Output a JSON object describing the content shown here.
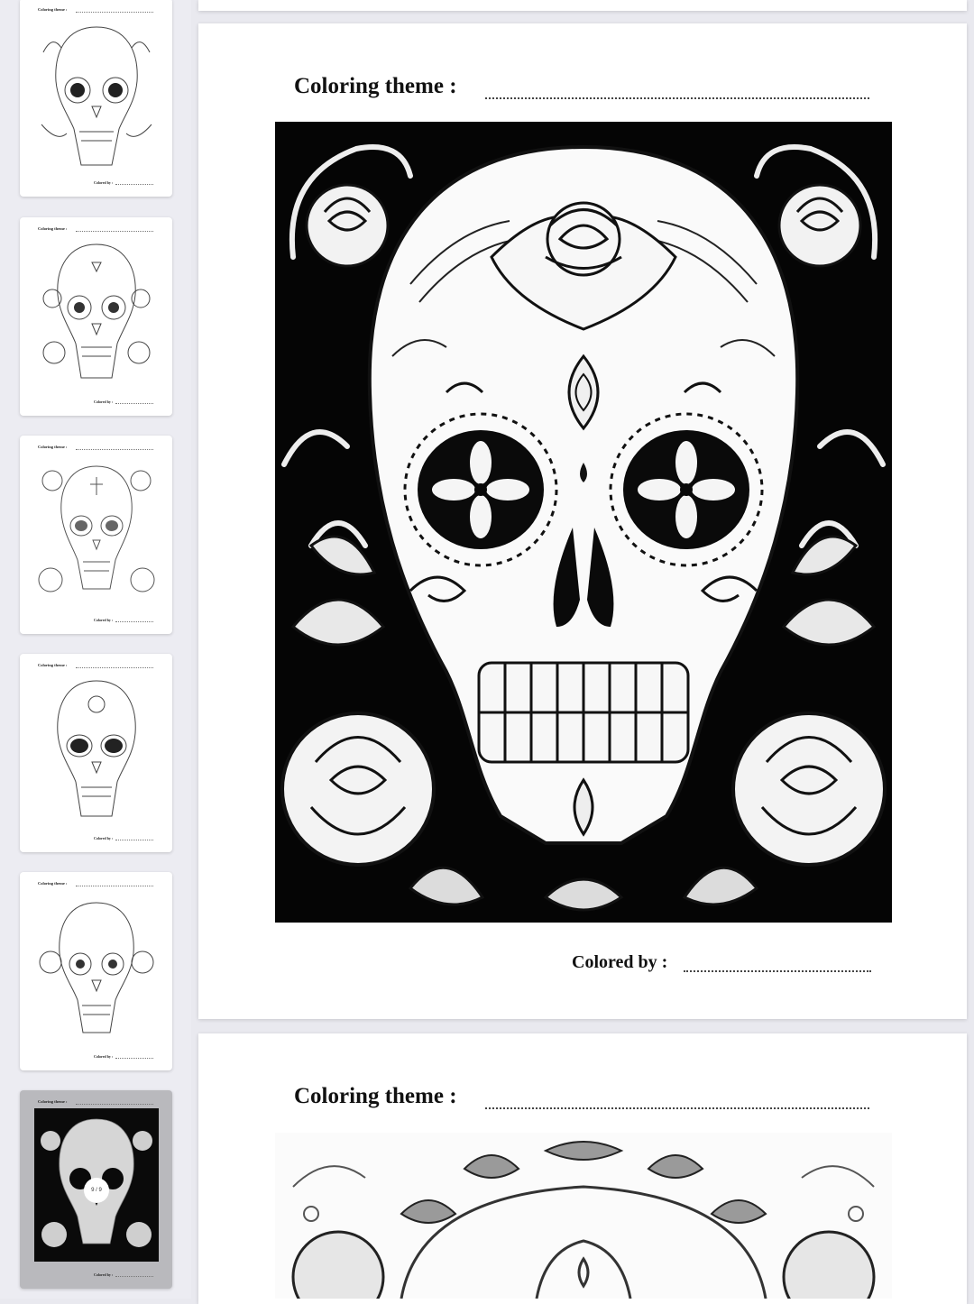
{
  "sidebar": {
    "thumbnails": [
      {
        "theme_label": "Coloring theme :",
        "colored_by_label": "Colored by :",
        "style": "light"
      },
      {
        "theme_label": "Coloring theme :",
        "colored_by_label": "Colored by :",
        "style": "light"
      },
      {
        "theme_label": "Coloring theme :",
        "colored_by_label": "Colored by :",
        "style": "light"
      },
      {
        "theme_label": "Coloring theme :",
        "colored_by_label": "Colored by :",
        "style": "light"
      },
      {
        "theme_label": "Coloring theme :",
        "colored_by_label": "Colored by :",
        "style": "light"
      },
      {
        "theme_label": "Coloring theme :",
        "colored_by_label": "Colored by :",
        "style": "dark",
        "selected": true
      }
    ],
    "selected_badge": "9 / 9"
  },
  "pages": [
    {
      "theme_label": "Coloring theme :",
      "colored_by_label": "Colored by :",
      "art": "sugar-skull-with-roses",
      "background": "#050505"
    },
    {
      "theme_label": "Coloring theme :",
      "art": "sugar-skull-with-leaves",
      "background": "#ffffff"
    }
  ]
}
